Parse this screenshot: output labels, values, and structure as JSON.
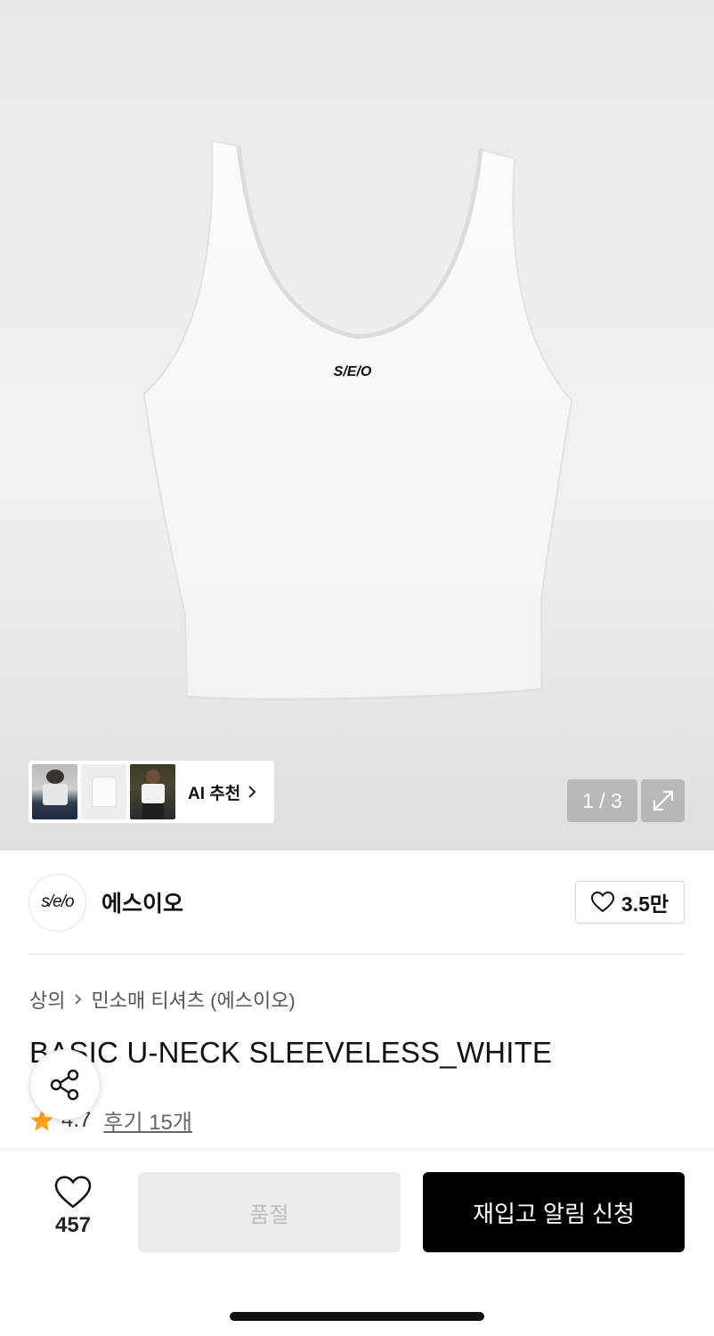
{
  "ai_recommend": {
    "label": "AI 추천"
  },
  "image_pager": {
    "text": "1 / 3"
  },
  "brand": {
    "logo_text": "s/e/o",
    "name": "에스이오",
    "likes": "3.5만"
  },
  "breadcrumb": {
    "category": "상의",
    "subcategory": "민소매 티셔츠 (에스이오)"
  },
  "product": {
    "title": "BASIC U-NECK SLEEVELESS_WHITE",
    "logo_print": "S/E/O",
    "rating": "4.7",
    "reviews": "후기 15개"
  },
  "bottom_bar": {
    "wish_count": "457",
    "soldout_label": "품절",
    "restock_label": "재입고 알림 신청"
  },
  "colors": {
    "accent_star": "#f7a21b",
    "primary_button": "#000000",
    "disabled_button": "#ebebeb"
  }
}
